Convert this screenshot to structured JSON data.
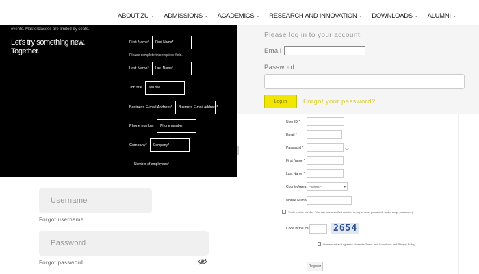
{
  "nav": {
    "items": [
      {
        "label": "ABOUT ZU"
      },
      {
        "label": "ADMISSIONS"
      },
      {
        "label": "ACADEMICS"
      },
      {
        "label": "RESEARCH AND INNOVATION"
      },
      {
        "label": "DOWNLOADS"
      },
      {
        "label": "ALUMNI"
      }
    ]
  },
  "promo": {
    "cut_text": "events. Masterclasses are limited by seats.",
    "tagline": "Let's try something new. Together.",
    "hint": "Please complete this required field.",
    "fields": [
      {
        "label": "First Name*",
        "placeholder": "First Name*"
      },
      {
        "label": "Last Name*",
        "placeholder": "Last Name*"
      },
      {
        "label": "Job title",
        "placeholder": "Job title"
      },
      {
        "label": "Business E-mail Address*",
        "placeholder": "Business E-mail Address*"
      },
      {
        "label": "Phone number",
        "placeholder": "Phone number"
      },
      {
        "label": "Company*",
        "placeholder": "Company*"
      },
      {
        "label": "",
        "placeholder": "Number of employees*"
      }
    ]
  },
  "login": {
    "intro": "Please log in to your account.",
    "email_label": "Email",
    "password_label": "Password",
    "login_button": "Log in",
    "forgot_password": "Forgot your password?"
  },
  "register": {
    "rows": [
      {
        "label": "User ID *",
        "value": ""
      },
      {
        "label": "Email *",
        "value": ""
      },
      {
        "label": "Password *",
        "value": ""
      },
      {
        "label": "First Name *",
        "value": ""
      },
      {
        "label": "Last Name *",
        "value": ""
      },
      {
        "label": "Country/Area *",
        "value": "--Select--"
      },
      {
        "label": "Mobile Number",
        "value": ""
      }
    ],
    "verify_text": "Verify mobile number (You can use a verified number to log in, reset password, and change password.)",
    "code_label": "Code in the image *",
    "captcha": "2654",
    "agree_text": "I have read and agree to Huawei's Terms and Conditions and Privacy Policy",
    "register_button": "Register"
  },
  "lower_login": {
    "username_placeholder": "Username",
    "forgot_username": "Forgot username",
    "password_placeholder": "Password",
    "forgot_password": "Forgot password"
  }
}
